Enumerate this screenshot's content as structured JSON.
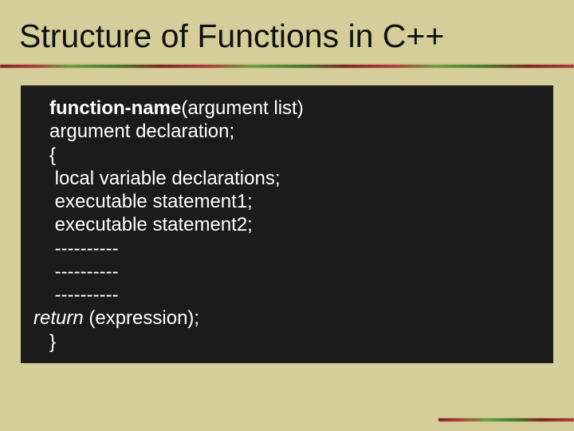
{
  "slide": {
    "title": "Structure of Functions in C++",
    "code": {
      "line1_bold": "function-name",
      "line1_rest": "(argument list)",
      "line2": "argument declaration;",
      "line3": "{",
      "line4": " local variable declarations;",
      "line5": " executable statement1;",
      "line6": " executable statement2;",
      "line7": " ----------",
      "line8": " ----------",
      "line9": " ----------",
      "line10_italic": "return",
      "line10_rest": " (expression);",
      "line11": "}"
    }
  }
}
